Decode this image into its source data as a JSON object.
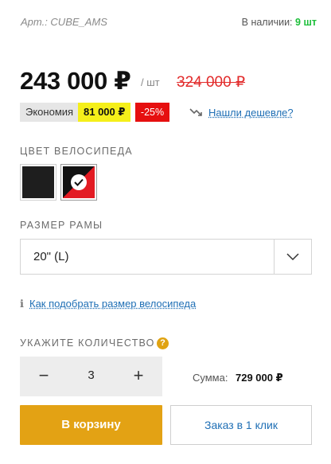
{
  "product": {
    "sku": "Арт.: CUBE_AMS",
    "stock_label": "В наличии:",
    "stock_value": "9 шт"
  },
  "pricing": {
    "price": "243 000 ₽",
    "unit": "/ шт",
    "old_price": "324 000 ₽",
    "savings_label": "Экономия",
    "savings_value": "81 000 ₽",
    "discount": "-25%",
    "cheaper_link": "Нашли дешевле?"
  },
  "color": {
    "label": "Цвет велосипеда",
    "options": [
      "black",
      "red-black"
    ],
    "selected": "red-black"
  },
  "frame": {
    "label": "Размер рамы",
    "selected": "20\" (L)",
    "guide_link": "Как подобрать размер велосипеда"
  },
  "quantity": {
    "label": "Укажите количество",
    "value": "3",
    "minus": "−",
    "plus": "+",
    "sum_label": "Сумма:",
    "sum_value": "729 000 ₽"
  },
  "actions": {
    "cart": "В корзину",
    "one_click": "Заказ в 1 клик"
  },
  "colors": {
    "accent": "#e3a214",
    "link": "#1f6fb5",
    "old_price": "#e22b2b",
    "stock": "#1dbf3a",
    "savings_bg": "#f5ef1a",
    "discount_bg": "#e60f0f"
  }
}
